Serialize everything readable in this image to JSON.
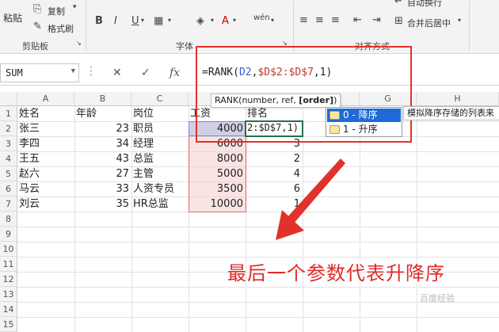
{
  "ribbon": {
    "paste_label": "粘贴",
    "copy_label": "复制",
    "format_painter_label": "格式刷",
    "clipboard_label": "剪贴板",
    "font_label": "字体",
    "align_label": "对齐方式",
    "wrap_text_label": "自动换行",
    "merge_center_label": "合并后居中"
  },
  "formula_bar": {
    "name_box": "SUM",
    "cancel_icon": "✕",
    "enter_icon": "✓",
    "fx_label": "fx",
    "formula_prefix": "=RANK(",
    "formula_ref1": "D2",
    "formula_sep1": ",",
    "formula_ref2": "$D$2:$D$7",
    "formula_tail": ",1)"
  },
  "tooltip": {
    "text_plain": "RANK(number, ref, ",
    "text_bold": "[order]",
    "text_end": ")"
  },
  "autocomplete": {
    "items": [
      {
        "label": "0 - 降序",
        "selected": true
      },
      {
        "label": "1 - 升序",
        "selected": false
      }
    ],
    "description": "模拟降序存储的列表来"
  },
  "columns": [
    "A",
    "B",
    "C",
    "D",
    "E",
    "F",
    "G",
    "H"
  ],
  "rows": [
    "1",
    "2",
    "3",
    "4",
    "5",
    "6",
    "7",
    "8",
    "9",
    "10",
    "11",
    "12",
    "13",
    "14",
    "15"
  ],
  "table": {
    "header": {
      "name": "姓名",
      "age": "年龄",
      "post": "岗位",
      "salary": "工资",
      "rank": "排名"
    },
    "records": [
      {
        "name": "张三",
        "age": "23",
        "post": "职员",
        "salary": "4000",
        "rank": "2:$D$7,1)"
      },
      {
        "name": "李四",
        "age": "34",
        "post": "经理",
        "salary": "6000",
        "rank": "3"
      },
      {
        "name": "王五",
        "age": "43",
        "post": "总监",
        "salary": "8000",
        "rank": "2"
      },
      {
        "name": "赵六",
        "age": "27",
        "post": "主管",
        "salary": "5000",
        "rank": "4"
      },
      {
        "name": "马云",
        "age": "33",
        "post": "人资专员",
        "salary": "3500",
        "rank": "6"
      },
      {
        "name": "刘云",
        "age": "35",
        "post": "HR总监",
        "salary": "10000",
        "rank": "1"
      }
    ]
  },
  "annotation": "最后一个参数代表升降序",
  "watermark": "百度经验",
  "colors": {
    "accent_red": "#e0322b",
    "selection_green": "#217346",
    "autocomplete_blue": "#1e6bd6"
  }
}
